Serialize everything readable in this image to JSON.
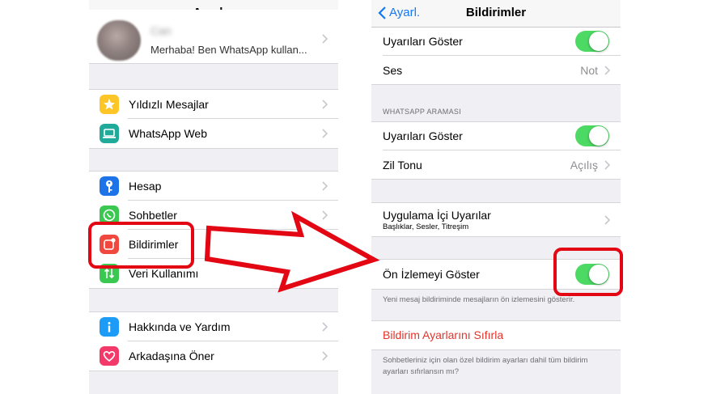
{
  "left": {
    "title": "Ayarlar",
    "profile": {
      "name": "Can",
      "status": "Merhaba! Ben WhatsApp kullan..."
    },
    "group1": [
      {
        "label": "Yıldızlı Mesajlar",
        "icon": "star-icon",
        "color": "#fdc525"
      },
      {
        "label": "WhatsApp Web",
        "icon": "laptop-icon",
        "color": "#1faa9a"
      }
    ],
    "group2": [
      {
        "label": "Hesap",
        "icon": "key-icon",
        "color": "#1c74e8"
      },
      {
        "label": "Sohbetler",
        "icon": "whatsapp-icon",
        "color": "#3bc851"
      },
      {
        "label": "Bildirimler",
        "icon": "notification-icon",
        "color": "#f0483e"
      },
      {
        "label": "Veri Kullanımı",
        "icon": "data-arrows-icon",
        "color": "#3bc851"
      }
    ],
    "group3": [
      {
        "label": "Hakkında ve Yardım",
        "icon": "info-icon",
        "color": "#1c9cf6"
      },
      {
        "label": "Arkadaşına Öner",
        "icon": "heart-icon",
        "color": "#f3386a"
      }
    ]
  },
  "right": {
    "title": "Bildirimler",
    "back_label": "Ayarl.",
    "messages": {
      "show_alerts": "Uyarıları Göster",
      "sound_label": "Ses",
      "sound_value": "Not"
    },
    "calls": {
      "header": "WHATSAPP ARAMASI",
      "show_alerts": "Uyarıları Göster",
      "ringtone_label": "Zil Tonu",
      "ringtone_value": "Açılış"
    },
    "in_app": {
      "label": "Uygulama İçi Uyarılar",
      "subtitle": "Başlıklar, Sesler, Titreşim"
    },
    "preview": {
      "label": "Ön İzlemeyi Göster",
      "footer": "Yeni mesaj bildiriminde mesajların ön izlemesini gösterir."
    },
    "reset": {
      "label": "Bildirim Ayarlarını Sıfırla",
      "footer": "Sohbetleriniz için olan özel bildirim ayarları dahil tüm bildirim ayarları sıfırlansın mı?"
    }
  },
  "colors": {
    "accent": "#1678f5",
    "toggle_on": "#4cd964",
    "highlight": "#e30613",
    "destructive": "#e3332b"
  }
}
